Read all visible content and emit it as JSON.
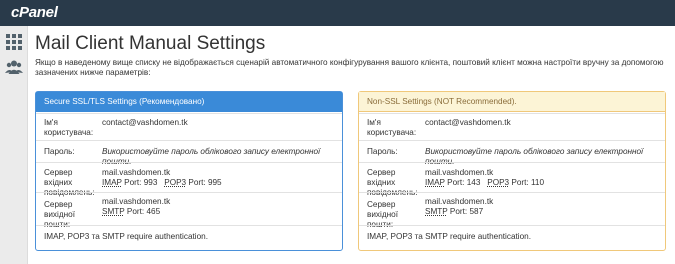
{
  "app": {
    "logo": "cPanel"
  },
  "sidebar": {
    "items": [
      {
        "icon": "grid-icon"
      },
      {
        "icon": "users-icon"
      }
    ]
  },
  "page": {
    "title": "Mail Client Manual Settings",
    "intro": "Якщо в наведеному вище списку не відображається сценарій автоматичного конфігурування вашого клієнта, поштовий клієнт можна настроїти вручну за допомогою зазначених нижче параметрів:"
  },
  "ssl": {
    "heading": "Secure SSL/TLS Settings (Рекомендовано)",
    "username_label": "Ім'я користувача:",
    "username": "contact@vashdomen.tk",
    "password_label": "Пароль:",
    "password_hint": "Використовуйте пароль облікового запису електронної пошти.",
    "incoming_label": "Сервер вхідних повідомлень:",
    "incoming_host": "mail.vashdomen.tk",
    "imap_label": "IMAP",
    "imap_port_word": "Port:",
    "imap_port": "993",
    "pop3_label": "POP3",
    "pop3_port_word": "Port:",
    "pop3_port": "995",
    "outgoing_label": "Сервер вихідної пошти:",
    "outgoing_host": "mail.vashdomen.tk",
    "smtp_label": "SMTP",
    "smtp_port_word": "Port:",
    "smtp_port": "465",
    "auth_note": "IMAP, POP3 та SMTP require authentication."
  },
  "nonssl": {
    "heading": "Non-SSL Settings (NOT Recommended).",
    "username_label": "Ім'я користувача:",
    "username": "contact@vashdomen.tk",
    "password_label": "Пароль:",
    "password_hint": "Використовуйте пароль облікового запису електронної пошти.",
    "incoming_label": "Сервер вхідних повідомлень:",
    "incoming_host": "mail.vashdomen.tk",
    "imap_label": "IMAP",
    "imap_port_word": "Port:",
    "imap_port": "143",
    "pop3_label": "POP3",
    "pop3_port_word": "Port:",
    "pop3_port": "110",
    "outgoing_label": "Сервер вихідної пошти:",
    "outgoing_host": "mail.vashdomen.tk",
    "smtp_label": "SMTP",
    "smtp_port_word": "Port:",
    "smtp_port": "587",
    "auth_note": "IMAP, POP3 та SMTP require authentication."
  },
  "colors": {
    "topbar": "#293a4a",
    "ssl_header": "#3a8ad8",
    "nonssl_header": "#fcf4d6",
    "nonssl_border": "#f0c87a"
  }
}
